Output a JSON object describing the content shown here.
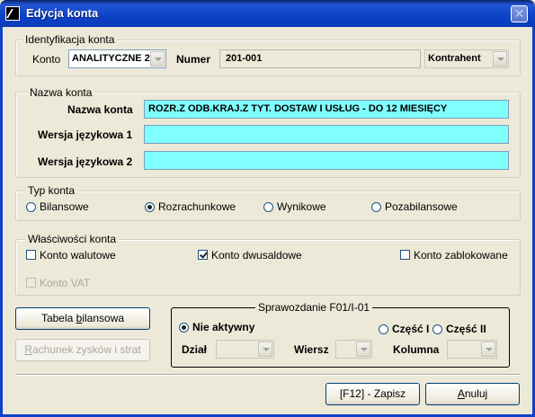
{
  "window": {
    "title": "Edycja konta",
    "close_glyph": "✕",
    "title_bar_color": "#0d43c9"
  },
  "identyfikacja": {
    "legend": "Identyfikacja konta",
    "konto_label": "Konto",
    "konto_value": "ANALITYCZNE 2",
    "numer_label": "Numer",
    "numer_value": "201-001",
    "typ_value": "Kontrahent"
  },
  "nazwa": {
    "legend": "Nazwa konta",
    "nazwa_label": "Nazwa konta",
    "nazwa_value": "ROZR.Z ODB.KRAJ.Z TYT. DOSTAW I USŁUG - DO 12 MIESIĘCY",
    "wersja1_label": "Wersja językowa 1",
    "wersja1_value": "",
    "wersja2_label": "Wersja językowa 2",
    "wersja2_value": "",
    "highlight_color": "#80ffff"
  },
  "typ_konta": {
    "legend": "Typ konta",
    "options": [
      "Bilansowe",
      "Rozrachunkowe",
      "Wynikowe",
      "Pozabilansowe"
    ],
    "selected": "Rozrachunkowe"
  },
  "wlasciwosci": {
    "legend": "Właściwości konta",
    "walutowe": "Konto walutowe",
    "walutowe_checked": false,
    "dwusaldowe": "Konto dwusaldowe",
    "dwusaldowe_checked": true,
    "zablokowane": "Konto zablokowane",
    "zablokowane_checked": false,
    "vat": "Konto VAT",
    "vat_checked": false
  },
  "buttons": {
    "tabela_pre": "Tabela ",
    "tabela_u": "b",
    "tabela_post": "ilansowa",
    "rachunek_u": "R",
    "rachunek_post": "achunek zysków i strat",
    "zapisz": "[F12] - Zapisz",
    "anuluj_u": "A",
    "anuluj_post": "nuluj"
  },
  "sprawozdanie": {
    "legend": "Sprawozdanie F01/I-01",
    "nie_aktywny": "Nie aktywny",
    "czesc1": "Część I",
    "czesc2": "Część II",
    "selected": "Nie aktywny",
    "dzial_label": "Dział",
    "wiersz_label": "Wiersz",
    "kolumna_label": "Kolumna"
  }
}
